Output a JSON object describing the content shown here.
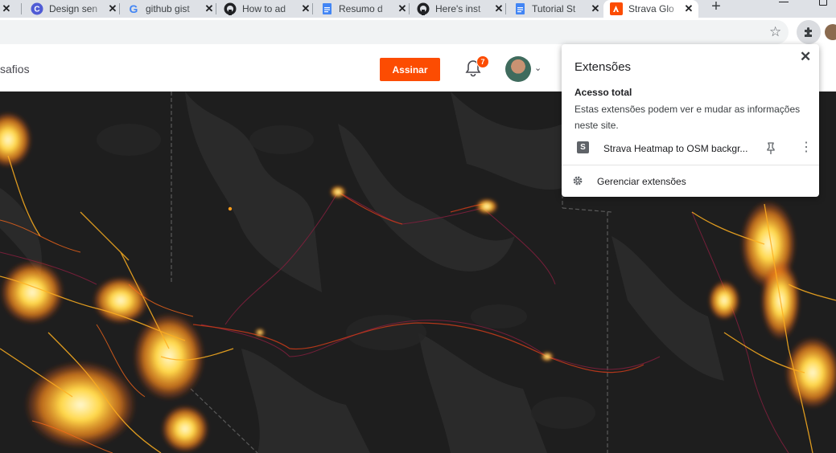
{
  "tabs": [
    {
      "title": "Design sen",
      "icon": "canva-icon"
    },
    {
      "title": "github gist",
      "icon": "google-icon"
    },
    {
      "title": "How to ad",
      "icon": "github-icon"
    },
    {
      "title": "Resumo d",
      "icon": "google-docs-icon"
    },
    {
      "title": "Here's inst",
      "icon": "github-icon"
    },
    {
      "title": "Tutorial St",
      "icon": "google-docs-icon"
    },
    {
      "title": "Strava Glo",
      "icon": "strava-icon",
      "active": true
    }
  ],
  "header": {
    "nav_label": "safios",
    "subscribe_label": "Assinar",
    "notification_count": "7"
  },
  "popup": {
    "title": "Extensões",
    "close_glyph": "✕",
    "access_heading": "Acesso total",
    "access_description": "Estas extensões podem ver e mudar as informações neste site.",
    "extension": {
      "letter": "S",
      "name": "Strava Heatmap to OSM backgr..."
    },
    "manage_label": "Gerenciar extensões"
  },
  "colors": {
    "strava_orange": "#fc4c02",
    "heat_core": "#ffe36e",
    "heat_mid": "#ff9c1a",
    "heat_low": "#c23a1a",
    "heat_trace": "#7e1f3c"
  }
}
